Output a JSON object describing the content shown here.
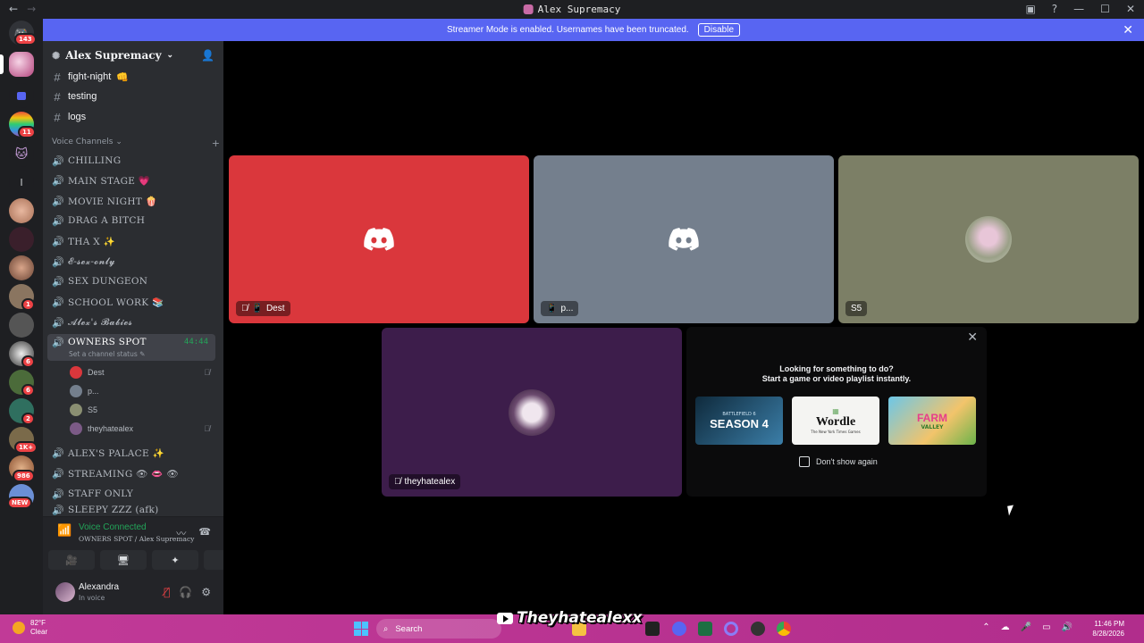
{
  "window": {
    "title": "Alex Supremacy"
  },
  "banner": {
    "message": "Streamer Mode is enabled. Usernames have been truncated.",
    "disable_label": "Disable"
  },
  "server_badges": {
    "home": "143",
    "s3": "11",
    "s10": "1",
    "s12": "6",
    "s13": "6",
    "s14": "2",
    "s15": "1K+",
    "s16": "986",
    "new": "NEW",
    "l_label": "l"
  },
  "guild": {
    "name": "Alex Supremacy"
  },
  "text_channels": [
    {
      "name": "fight-night",
      "emoji": "👊"
    },
    {
      "name": "testing",
      "emoji": ""
    },
    {
      "name": "logs",
      "emoji": ""
    }
  ],
  "voice_section": {
    "label": "Voice Channels"
  },
  "voice_channels": [
    {
      "name": "CHILLING"
    },
    {
      "name": "MAIN STAGE 💗"
    },
    {
      "name": "MOVIE NIGHT 🍿"
    },
    {
      "name": "DRAG A BITCH"
    },
    {
      "name": "THA X ✨"
    },
    {
      "name": "𝓔-𝓼𝓮𝔁-𝓸𝓷𝓵𝔂"
    },
    {
      "name": "SEX DUNGEON"
    },
    {
      "name": "SCHOOL WORK 📚"
    },
    {
      "name": "𝓐𝓵𝓮𝔁'𝓼 𝓑𝓪𝓫𝓲𝓮𝓼"
    }
  ],
  "active_channel": {
    "name": "OWNERS SPOT",
    "timer": "44:44",
    "status": "Set a channel status"
  },
  "members": [
    {
      "name": "Dest",
      "muted": true
    },
    {
      "name": "p...",
      "muted": false
    },
    {
      "name": "S5",
      "muted": false
    },
    {
      "name": "theyhatealex",
      "muted": true
    }
  ],
  "more_channels": [
    {
      "name": "ALEX'S PALACE ✨"
    },
    {
      "name": "STREAMING 👁 👄 👁"
    },
    {
      "name": "STAFF ONLY"
    },
    {
      "name": "SLEEPY ZZZ (afk)"
    }
  ],
  "voice_status": {
    "title": "Voice Connected",
    "location": "OWNERS SPOT / Alex Supremacy"
  },
  "user": {
    "name": "Alexandra",
    "status": "In voice"
  },
  "tiles": [
    {
      "label": "Dest",
      "color": "#da373c"
    },
    {
      "label": "p...",
      "color": "#747f8d"
    },
    {
      "label": "S5",
      "color": "#7c7f66"
    },
    {
      "label": "theyhatealex",
      "color": "#3d1d4b"
    }
  ],
  "activity": {
    "line1": "Looking for something to do?",
    "line2": "Start a game or video playlist instantly.",
    "games": [
      {
        "title": "SEASON 4",
        "sub": "BATTLEFIELD 6"
      },
      {
        "title": "Wordle",
        "sub": "The New York Times Games"
      },
      {
        "title": "FARM",
        "sub": "VALLEY"
      }
    ],
    "dont_show": "Don't show again"
  },
  "overlay": {
    "handle": "Theyhatealexx"
  },
  "taskbar": {
    "temp": "82°F",
    "weather": "Clear",
    "search": "Search",
    "time": "11:46 PM",
    "date": "8/28/2026"
  }
}
